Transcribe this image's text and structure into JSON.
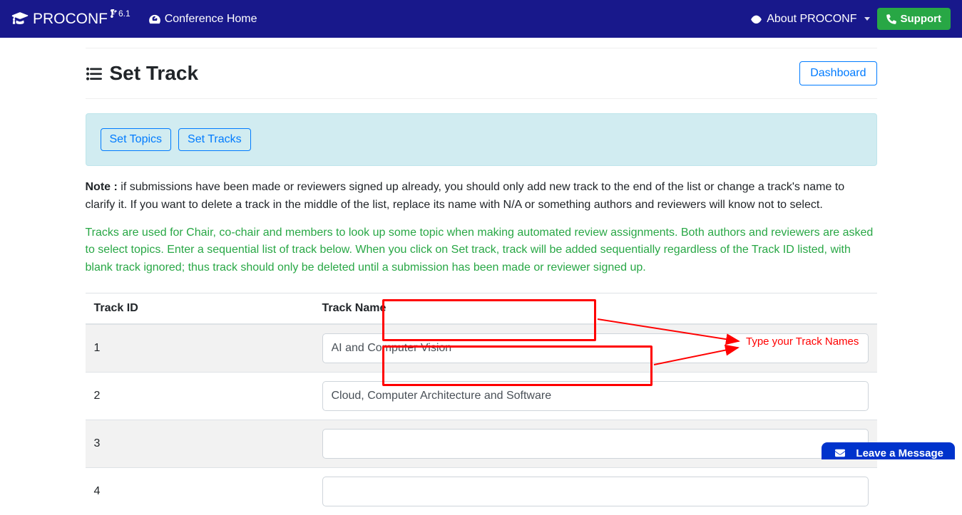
{
  "nav": {
    "brand": "PROCONF",
    "version": "6.1",
    "home_label": "Conference Home",
    "about_label": "About PROCONF",
    "support_label": "Support"
  },
  "page": {
    "title": "Set Track",
    "dashboard_label": "Dashboard"
  },
  "panel": {
    "set_topics": "Set Topics",
    "set_tracks": "Set Tracks"
  },
  "note": {
    "label": "Note :",
    "body": "if submissions have been made or reviewers signed up already, you should only add new track to the end of the list or change a track's name to clarify it. If you want to delete a track in the middle of the list, replace its name with N/A or something authors and reviewers will know not to select."
  },
  "help": "Tracks are used for Chair, co-chair and members to look up some topic when making automated review assignments. Both authors and reviewers are asked to select topics. Enter a sequential list of track below. When you click on Set track, track will be added sequentially regardless of the Track ID listed, with blank track ignored; thus track should only be deleted until a submission has been made or reviewer signed up.",
  "table": {
    "col_id": "Track ID",
    "col_name": "Track Name",
    "rows": [
      {
        "id": "1",
        "name": "AI and Computer Vision"
      },
      {
        "id": "2",
        "name": "Cloud, Computer Architecture and Software"
      },
      {
        "id": "3",
        "name": ""
      },
      {
        "id": "4",
        "name": ""
      }
    ]
  },
  "annotation": {
    "label": "Type your Track Names"
  },
  "chat": {
    "label": "Leave a Message"
  }
}
